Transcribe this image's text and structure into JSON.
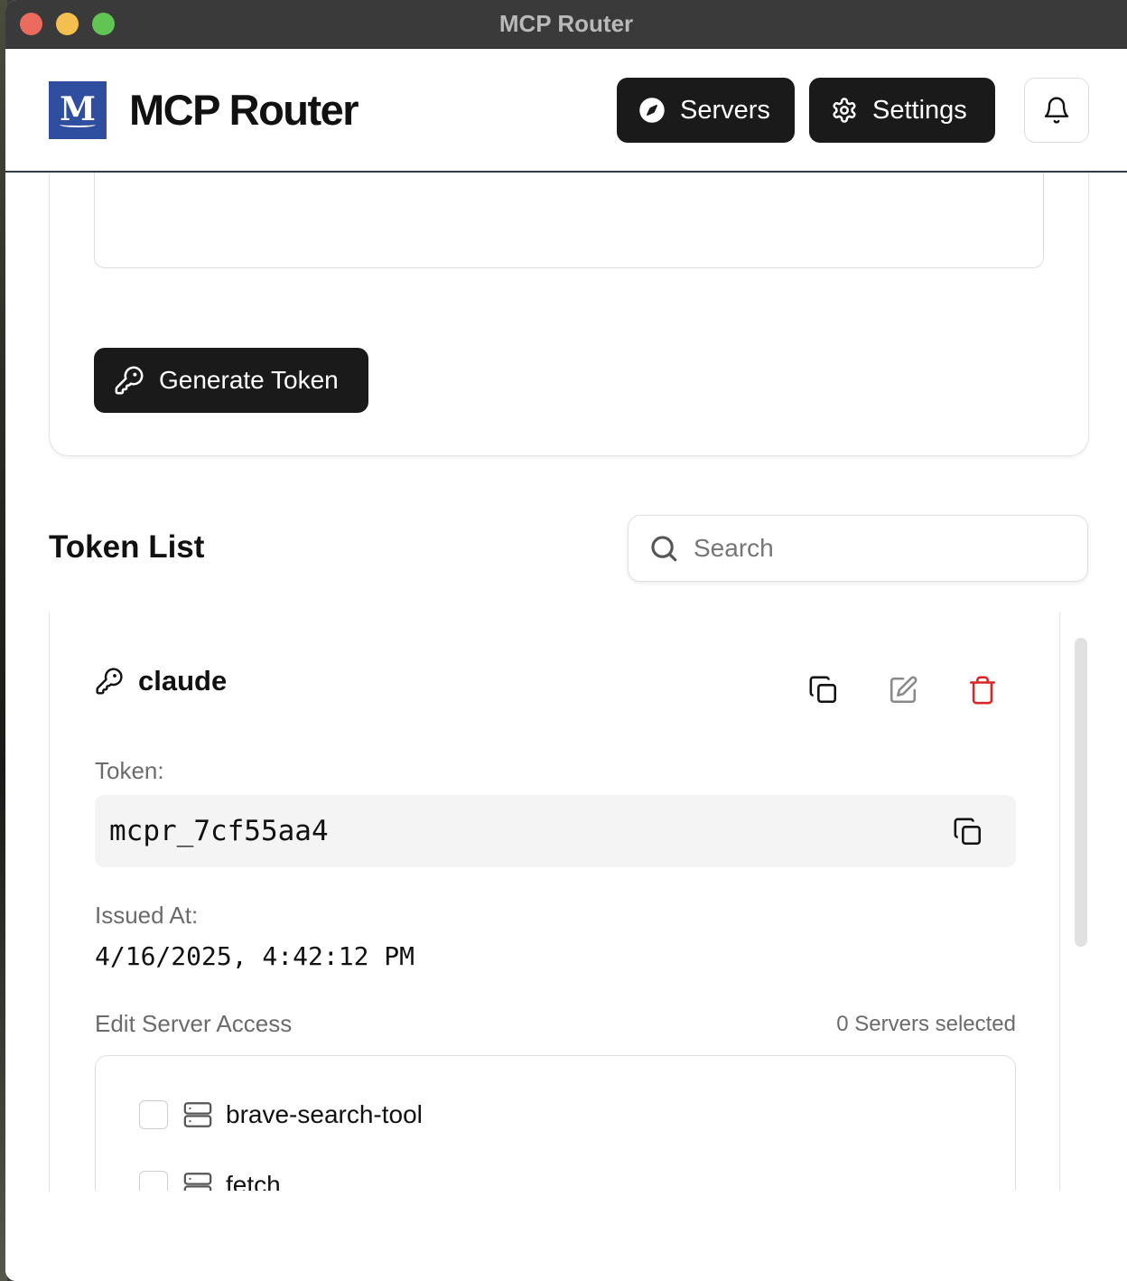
{
  "window": {
    "title": "MCP Router"
  },
  "header": {
    "logo_letter": "M",
    "app_name": "MCP Router",
    "nav": {
      "servers_label": "Servers",
      "settings_label": "Settings"
    }
  },
  "generate": {
    "button_label": "Generate Token"
  },
  "token_list": {
    "title": "Token List",
    "search_placeholder": "Search",
    "tokens": [
      {
        "name": "claude",
        "token_label": "Token:",
        "token_value": "mcpr_7cf55aa4",
        "issued_label": "Issued At:",
        "issued_value": "4/16/2025, 4:42:12 PM",
        "access_label": "Edit Server Access",
        "servers_selected": "0 Servers selected",
        "servers": [
          {
            "name": "brave-search-tool",
            "checked": false
          },
          {
            "name": "fetch",
            "checked": false
          }
        ]
      }
    ]
  },
  "colors": {
    "delete": "#dc2626",
    "dark_button": "#1a1a1a",
    "logo_bg": "#2f4ea0"
  }
}
